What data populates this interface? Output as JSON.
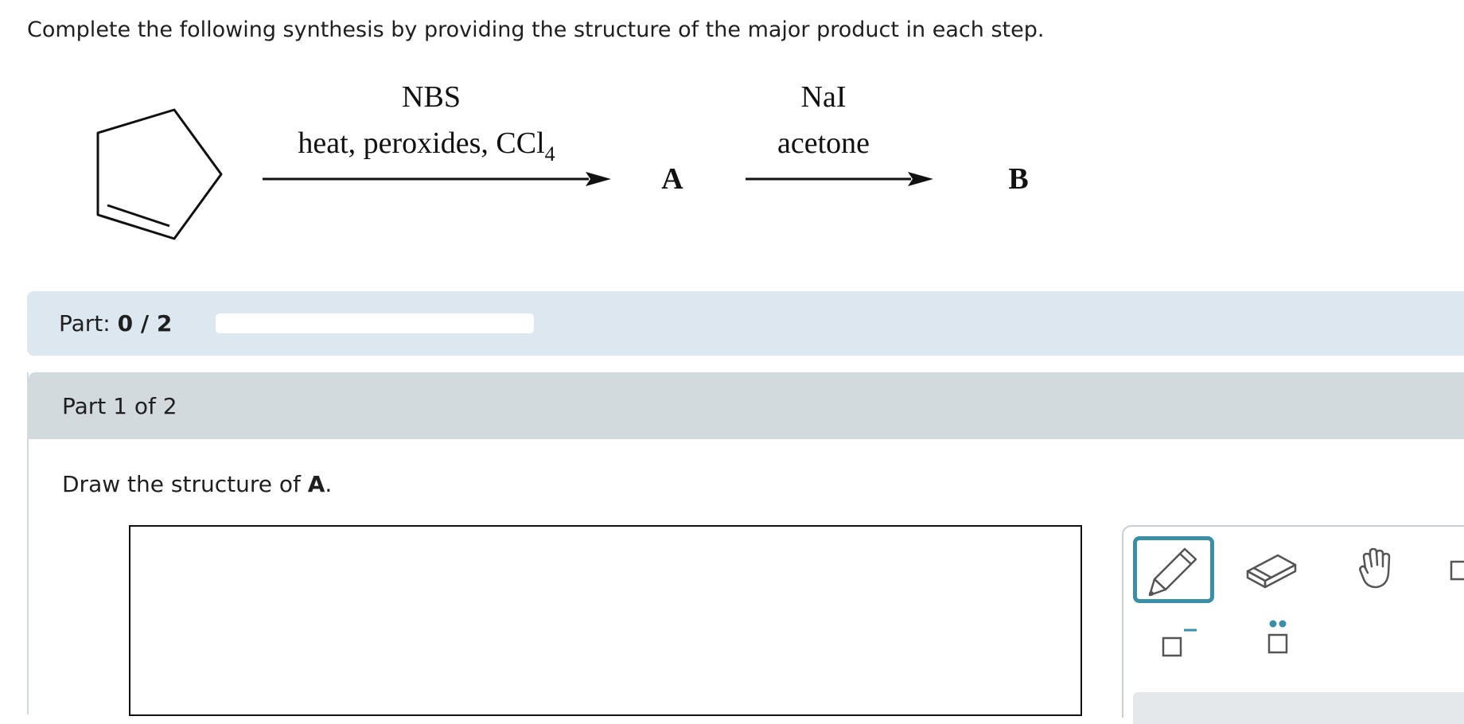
{
  "question": {
    "text": "Complete the following synthesis by providing the structure of the major product in each step."
  },
  "scheme": {
    "step1": {
      "reagent_top": "NBS",
      "reagent_bottom": "heat, peroxides, CCl",
      "reagent_subscript": "4"
    },
    "product_a": "A",
    "step2": {
      "reagent_top": "NaI",
      "reagent_bottom": "acetone"
    },
    "product_b": "B"
  },
  "progress": {
    "label": "Part:",
    "value": "0 / 2",
    "fraction": 0
  },
  "part": {
    "title": "Part 1 of 2",
    "prompt_prefix": "Draw the structure of ",
    "prompt_bold": "A",
    "prompt_suffix": "."
  },
  "toolbar": {
    "tools": [
      {
        "icon": "pencil-icon",
        "selected": true
      },
      {
        "icon": "eraser-icon",
        "selected": false
      },
      {
        "icon": "hand-icon",
        "selected": false
      },
      {
        "icon": "charge-box-icon",
        "selected": false
      },
      {
        "icon": "negative-charge-icon",
        "selected": false
      },
      {
        "icon": "lone-pair-icon",
        "selected": false
      }
    ],
    "accent_color": "#3a8ea5"
  }
}
